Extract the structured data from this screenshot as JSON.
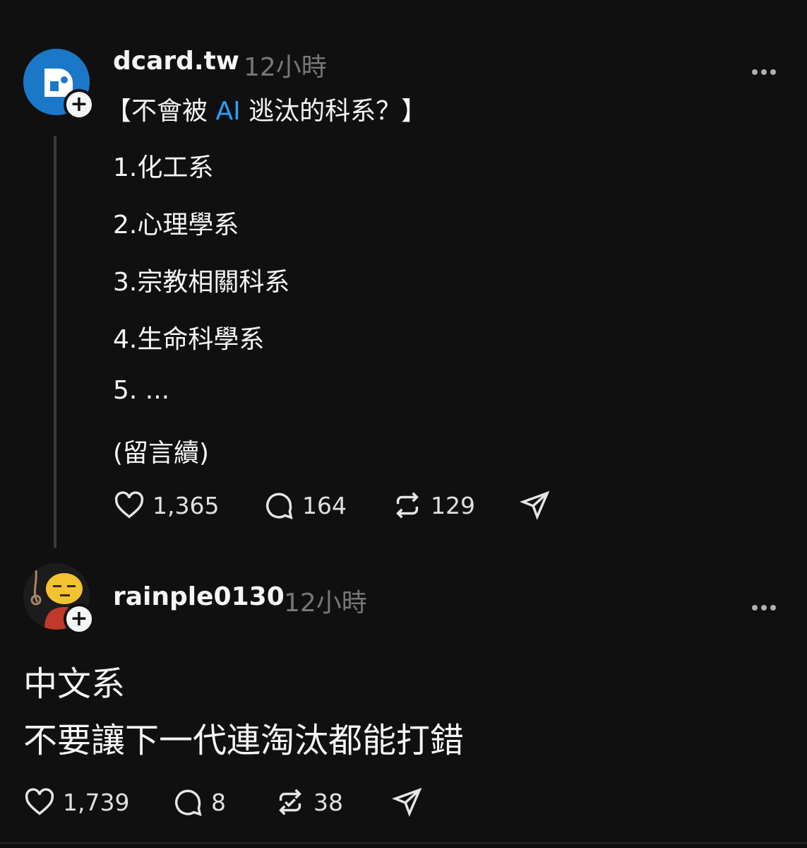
{
  "post": {
    "username": "dcard.tw",
    "time": "12小時",
    "title_pre": "【不會被 ",
    "title_accent": "AI",
    "title_post": " 逃汰的科系？】",
    "lines": [
      "1.化工系",
      "2.心理學系",
      "3.宗教相關科系",
      "4.生命科學系",
      "5. ...",
      "(留言續)"
    ],
    "likes": "1,365",
    "comments": "164",
    "reposts": "129"
  },
  "reply": {
    "username": "rainple0130",
    "time": "12小時",
    "lines": [
      "中文系",
      "不要讓下一代連淘汰都能打錯"
    ],
    "likes": "1,739",
    "comments": "8",
    "reposts": "38"
  },
  "icons": [
    "heart-icon",
    "comment-icon",
    "repost-icon",
    "share-icon",
    "more-icon",
    "plus-icon"
  ],
  "colors": {
    "background": "#101010",
    "text": "#f3f5f7",
    "muted": "#777777",
    "accent": "#2f9ef4"
  }
}
